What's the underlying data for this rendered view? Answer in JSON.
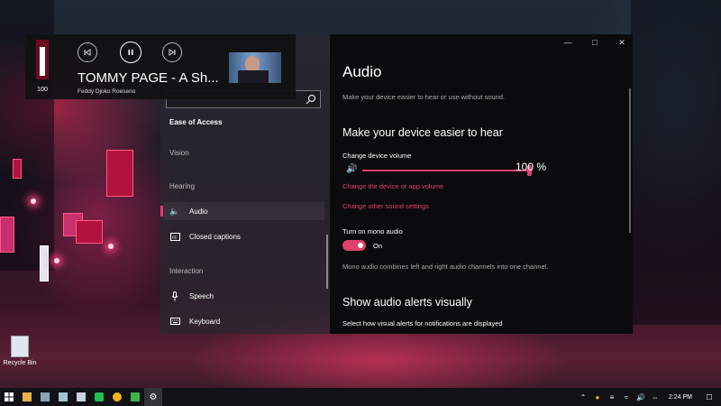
{
  "desktop": {
    "icon_label": "Recycle Bin"
  },
  "media_overlay": {
    "volume_value": "100",
    "volume_level": 0.9,
    "track_title": "TOMMY PAGE - A Sh...",
    "track_artist": "Feddy Djoko Roeseno",
    "prev_icon": "skip-previous-icon",
    "play_icon": "pause-icon",
    "next_icon": "skip-next-icon"
  },
  "settings": {
    "nav": {
      "search_placeholder": "",
      "section_title": "Ease of Access",
      "groups": {
        "vision": "Vision",
        "hearing": "Hearing",
        "interaction": "Interaction"
      },
      "items": {
        "audio": "Audio",
        "closed_captions": "Closed captions",
        "speech": "Speech",
        "keyboard": "Keyboard"
      }
    },
    "content": {
      "title": "Audio",
      "subtitle": "Make your device easier to hear or use without sound.",
      "heading_hear": "Make your device easier to hear",
      "volume_label": "Change device volume",
      "volume_value": "100 %",
      "volume_level": 1.0,
      "link_app_volume": "Change the device or app volume",
      "link_sound_settings": "Change other sound settings",
      "mono_label": "Turn on mono audio",
      "mono_state": "On",
      "mono_desc": "Mono audio combines left and right audio channels into one channel.",
      "heading_alerts": "Show audio alerts visually",
      "alerts_label": "Select how visual alerts for notifications are displayed"
    }
  },
  "taskbar": {
    "clock": "2:24 PM",
    "accent": "#e0416b"
  }
}
